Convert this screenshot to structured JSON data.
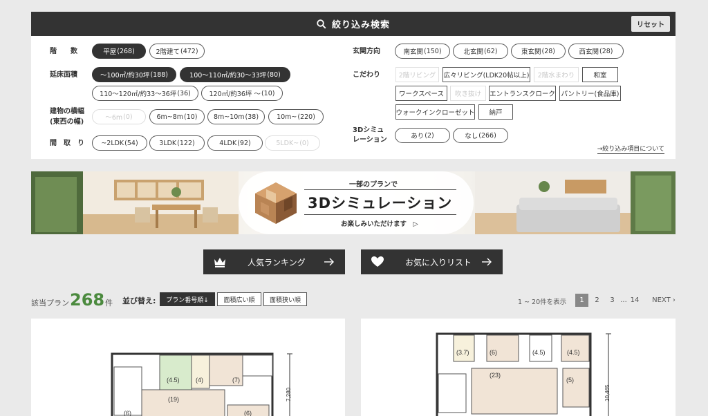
{
  "search": {
    "title": "絞り込み検索",
    "reset_label": "リセット",
    "icon": "search-icon"
  },
  "filters": {
    "floors": {
      "label": "階　　数",
      "options": [
        {
          "label": "平屋",
          "count": "(268)",
          "state": "active"
        },
        {
          "label": "2階建て",
          "count": "(472)",
          "state": "normal"
        }
      ]
    },
    "area": {
      "label": "延床面積",
      "options": [
        {
          "label": "～100㎡/約30坪",
          "count": "(188)",
          "state": "active"
        },
        {
          "label": "100～110㎡/約30～33坪",
          "count": "(80)",
          "state": "active"
        },
        {
          "label": "110～120㎡/約33～36坪",
          "count": "(36)",
          "state": "normal"
        },
        {
          "label": "120㎡/約36坪 ～",
          "count": "(10)",
          "state": "normal"
        }
      ]
    },
    "width": {
      "label_line1": "建物の横幅",
      "label_line2": "(東西の幅)",
      "options": [
        {
          "label": "～6m",
          "count": "(0)",
          "state": "disabled"
        },
        {
          "label": "6m~8m",
          "count": "(10)",
          "state": "normal"
        },
        {
          "label": "8m~10m",
          "count": "(38)",
          "state": "normal"
        },
        {
          "label": "10m~",
          "count": "(220)",
          "state": "normal"
        }
      ]
    },
    "layout": {
      "label": "間　取　り",
      "options": [
        {
          "label": "~2LDK",
          "count": "(54)",
          "state": "normal"
        },
        {
          "label": "3LDK",
          "count": "(122)",
          "state": "normal"
        },
        {
          "label": "4LDK",
          "count": "(92)",
          "state": "normal"
        },
        {
          "label": "5LDK~",
          "count": "(0)",
          "state": "disabled"
        }
      ]
    },
    "entrance": {
      "label": "玄関方向",
      "options": [
        {
          "label": "南玄関",
          "count": "(150)",
          "state": "normal"
        },
        {
          "label": "北玄関",
          "count": "(62)",
          "state": "normal"
        },
        {
          "label": "東玄関",
          "count": "(28)",
          "state": "normal"
        },
        {
          "label": "西玄関",
          "count": "(28)",
          "state": "normal"
        }
      ]
    },
    "features": {
      "label": "こだわり",
      "options": [
        {
          "label": "2階リビング",
          "state": "disabled"
        },
        {
          "label": "広々リビング(LDK20帖以上)",
          "state": "normal"
        },
        {
          "label": "2階水まわり",
          "state": "disabled"
        },
        {
          "label": "和室",
          "state": "normal"
        },
        {
          "label": "ワークスペース",
          "state": "normal"
        },
        {
          "label": "吹き抜け",
          "state": "disabled"
        },
        {
          "label": "エントランスクローク",
          "state": "normal"
        },
        {
          "label": "パントリー(食品庫)",
          "state": "normal"
        },
        {
          "label": "ウォークインクローゼット",
          "state": "normal"
        },
        {
          "label": "納戸",
          "state": "normal"
        }
      ]
    },
    "sim3d": {
      "label_line1": "3Dシミュ",
      "label_line2": "レーション",
      "options": [
        {
          "label": "あり",
          "count": "(2)",
          "state": "normal"
        },
        {
          "label": "なし",
          "count": "(266)",
          "state": "normal"
        }
      ]
    },
    "about_link": "→絞り込み項目について"
  },
  "banner": {
    "sub": "一部のプランで",
    "main": "3Dシミュレーション",
    "foot": "お楽しみいただけます　▷"
  },
  "actions": {
    "ranking": "人気ランキング",
    "favorites": "お気に入りリスト"
  },
  "results": {
    "prefix": "該当プラン",
    "count": "268",
    "suffix": "件",
    "sort_label": "並び替え:",
    "sort_options": [
      "プラン番号順↓",
      "面積広い順",
      "面積狭い順"
    ],
    "range": "1 ~ 20件を表示",
    "pages": [
      "1",
      "2",
      "3",
      "...",
      "14"
    ],
    "next": "NEXT ›"
  },
  "plans": [
    {
      "dimension": "7,280",
      "rooms": [
        "(4.5)",
        "(4)",
        "(7)",
        "(19)",
        "(6)",
        "(6)"
      ]
    },
    {
      "dimension": "10,465",
      "rooms": [
        "(3.7)",
        "(6)",
        "(4.5)",
        "(4.5)",
        "(23)",
        "(5)"
      ]
    }
  ],
  "colors": {
    "dark": "#333333",
    "accent_green": "#4b8a3e",
    "tatami": "#d8ebcc",
    "floor_beige": "#f1e4d6"
  }
}
